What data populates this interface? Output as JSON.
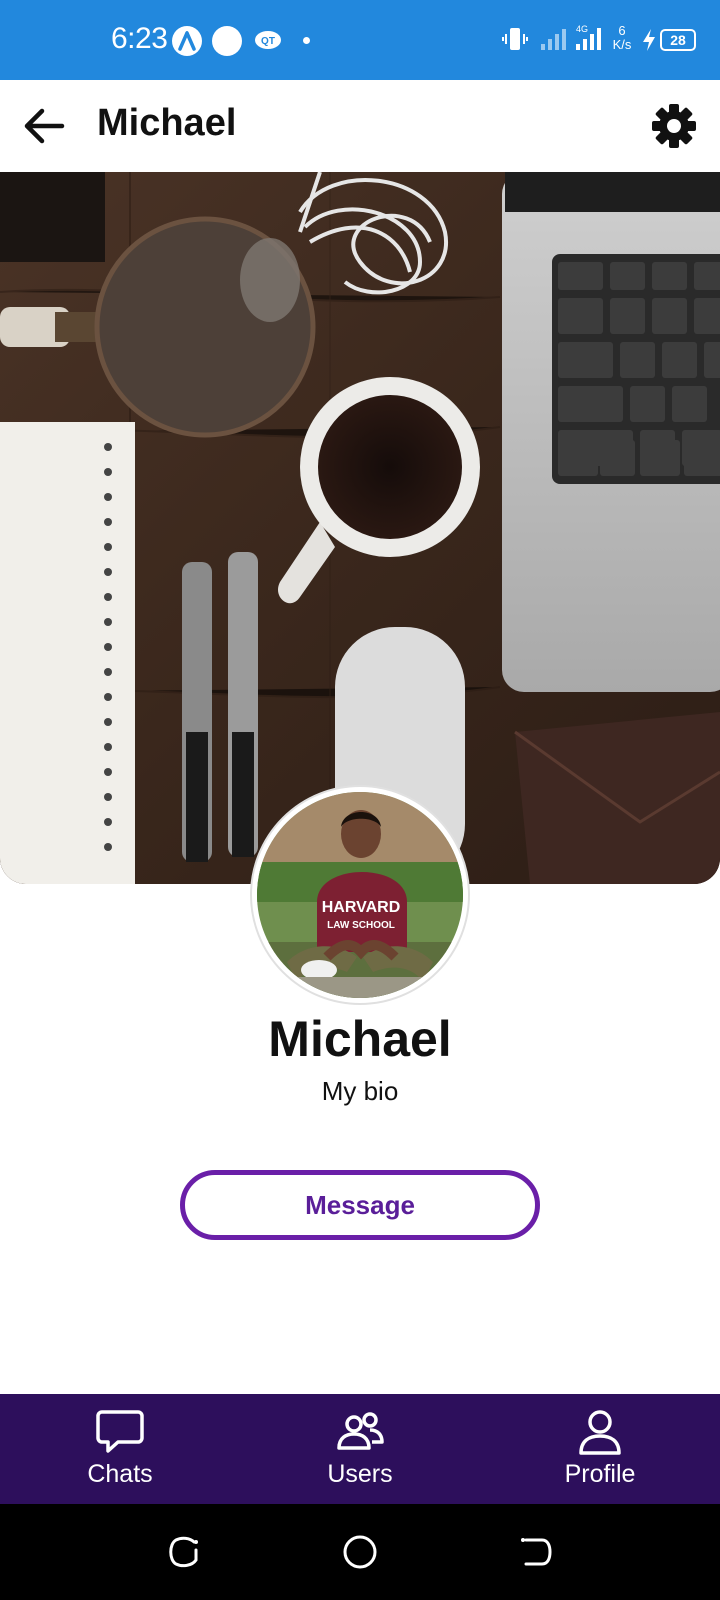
{
  "status_bar": {
    "time": "6:23",
    "network_speed_value": "6",
    "network_speed_unit": "K/s",
    "battery": "28"
  },
  "app_bar": {
    "title": "Michael",
    "back_icon": "arrow-left-icon",
    "settings_icon": "gear-icon"
  },
  "profile": {
    "name": "Michael",
    "bio": "My bio",
    "message_label": "Message"
  },
  "bottom_nav": {
    "items": [
      {
        "label": "Chats",
        "icon": "chat-bubble-icon"
      },
      {
        "label": "Users",
        "icon": "users-icon"
      },
      {
        "label": "Profile",
        "icon": "person-icon"
      }
    ]
  },
  "colors": {
    "status_bar": "#2288dd",
    "accent": "#6a1fa8",
    "bottom_nav": "#2d0f5c"
  }
}
